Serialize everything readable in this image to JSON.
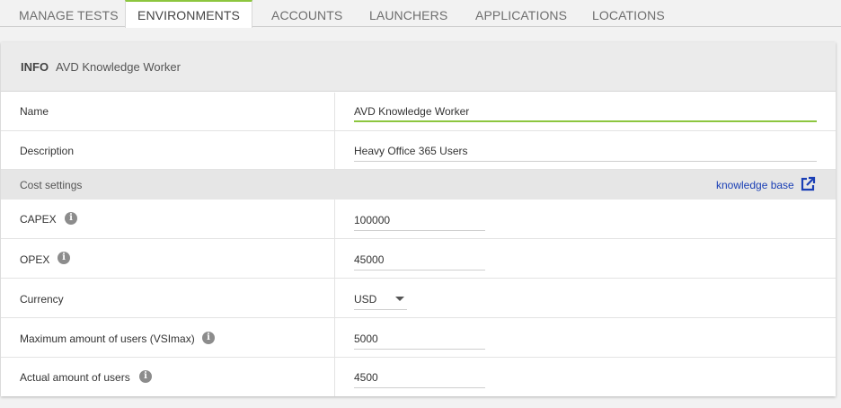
{
  "tabs": [
    {
      "label": "MANAGE TESTS"
    },
    {
      "label": "ENVIRONMENTS",
      "active": true
    },
    {
      "label": "ACCOUNTS"
    },
    {
      "label": "LAUNCHERS"
    },
    {
      "label": "APPLICATIONS"
    },
    {
      "label": "LOCATIONS"
    }
  ],
  "header": {
    "title": "INFO",
    "subtitle": "AVD Knowledge Worker"
  },
  "fields": {
    "name": {
      "label": "Name",
      "value": "AVD Knowledge Worker"
    },
    "description": {
      "label": "Description",
      "value": "Heavy Office 365 Users"
    }
  },
  "cost": {
    "section_label": "Cost settings",
    "kb_link": "knowledge base",
    "capex": {
      "label": "CAPEX",
      "value": "100000"
    },
    "opex": {
      "label": "OPEX",
      "value": "45000"
    },
    "currency": {
      "label": "Currency",
      "value": "USD"
    },
    "max_users": {
      "label": "Maximum amount of users (VSImax)",
      "value": "5000"
    },
    "actual_users": {
      "label": "Actual amount of users",
      "value": "4500"
    }
  },
  "icons": {
    "info": "info-icon",
    "external": "external-link-icon",
    "dropdown": "chevron-down-icon"
  },
  "colors": {
    "accent": "#8dc63f",
    "link": "#1a3fb5"
  }
}
